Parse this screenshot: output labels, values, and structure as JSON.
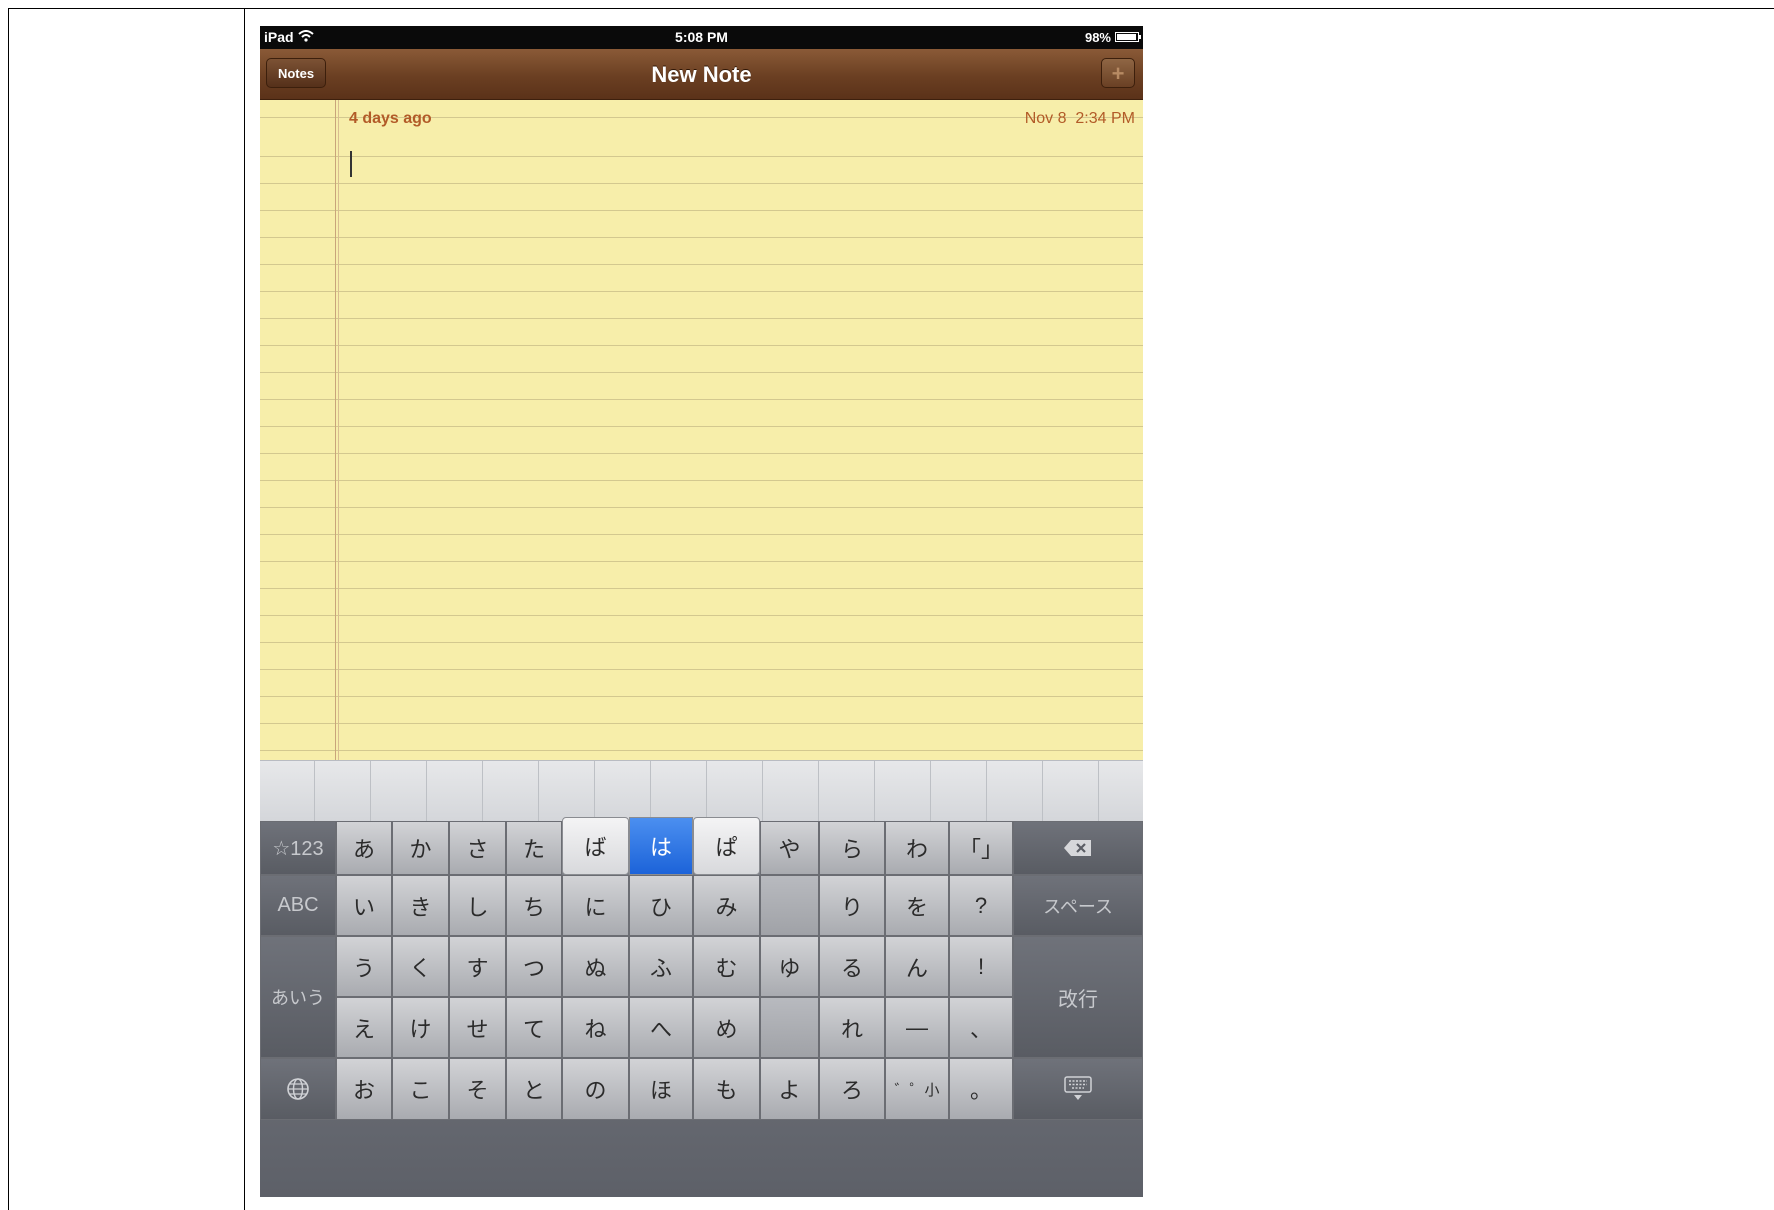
{
  "status_bar": {
    "device": "iPad",
    "time": "5:08 PM",
    "battery": "98%"
  },
  "nav_bar": {
    "back_label": "Notes",
    "title": "New Note",
    "add_label": "+"
  },
  "note": {
    "relative_date": "4 days ago",
    "date": "Nov 8",
    "time": "2:34 PM",
    "text": ""
  },
  "keyboard": {
    "row1": {
      "mode": "☆123",
      "keys": [
        "あ",
        "か",
        "さ",
        "た"
      ],
      "popup": [
        "ば",
        "は",
        "ぱ"
      ],
      "keys2": [
        "や",
        "ら",
        "わ",
        "「」"
      ]
    },
    "row2": {
      "mode": "ABC",
      "keys": [
        "い",
        "き",
        "し",
        "ち",
        "に",
        "ひ",
        "み",
        "",
        "り",
        "を",
        "?"
      ],
      "space": "スペース"
    },
    "row3": {
      "keys": [
        "う",
        "く",
        "す",
        "つ",
        "ぬ",
        "ふ",
        "む",
        "ゆ",
        "る",
        "ん",
        "!"
      ]
    },
    "row4": {
      "keys": [
        "え",
        "け",
        "せ",
        "て",
        "ね",
        "へ",
        "め",
        "",
        "れ",
        "—",
        "、"
      ]
    },
    "row5": {
      "keys": [
        "お",
        "こ",
        "そ",
        "と",
        "の",
        "ほ",
        "も",
        "よ",
        "ろ",
        "゛゜小",
        "。"
      ]
    },
    "kana_mode": "あいう",
    "return_label": "改行",
    "popup_selected": "は"
  }
}
